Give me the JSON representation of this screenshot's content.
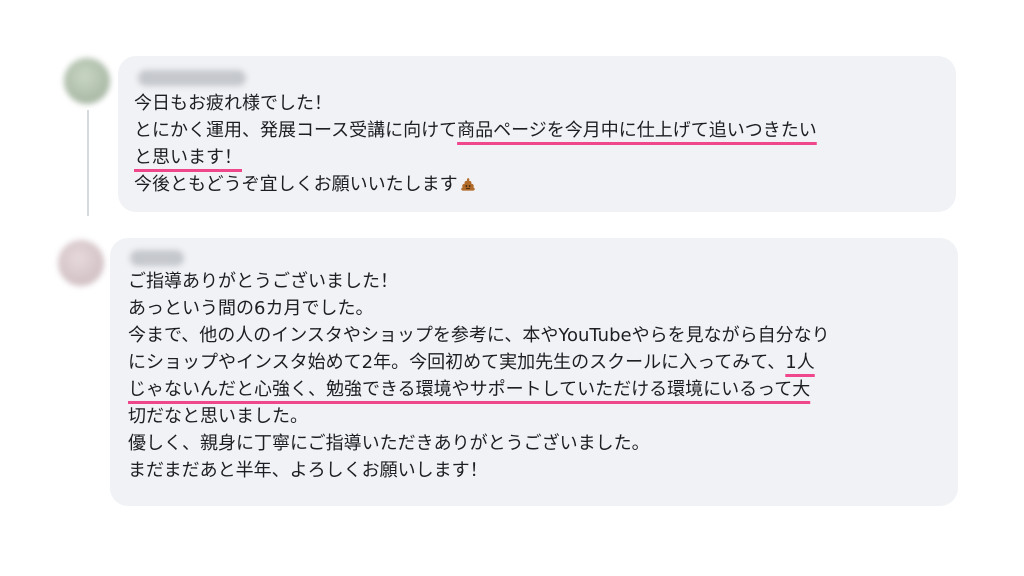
{
  "comments": [
    {
      "lines": [
        [
          {
            "text": "今日もお疲れ様でした！"
          }
        ],
        [
          {
            "text": "とにかく運用、発展コース受講に向けて"
          },
          {
            "text": "商品ページを今月中に仕上げて追いつきたい",
            "highlight": true
          }
        ],
        [
          {
            "text": "と思います！",
            "highlight": true
          }
        ],
        [
          {
            "text": "今後ともどうぞ宜しくお願いいたします"
          }
        ]
      ],
      "trailing_icon": "poop-emoji-icon"
    },
    {
      "lines": [
        [
          {
            "text": "ご指導ありがとうございました！"
          }
        ],
        [
          {
            "text": "あっという間の6カ月でした。"
          }
        ],
        [
          {
            "text": "今まで、他の人のインスタやショップを参考に、本やYouTubeやらを見ながら自分なり"
          }
        ],
        [
          {
            "text": "にショップやインスタ始めて2年。今回初めて実加先生のスクールに入ってみて、"
          },
          {
            "text": "1人",
            "highlight": true
          }
        ],
        [
          {
            "text": "じゃないんだと心強く、勉強できる環境やサポートしていただける環境にいるって大",
            "highlight": true
          }
        ],
        [
          {
            "text": "切だなと思いました。"
          }
        ],
        [
          {
            "text": "優しく、親身に丁寧にご指導いただきありがとうございました。"
          }
        ],
        [
          {
            "text": "まだまだあと半年、よろしくお願いします！"
          }
        ]
      ]
    }
  ],
  "colors": {
    "bubble_background": "#f0f2f5",
    "highlight_underline": "#f0468c",
    "text": "#1c1e21"
  }
}
